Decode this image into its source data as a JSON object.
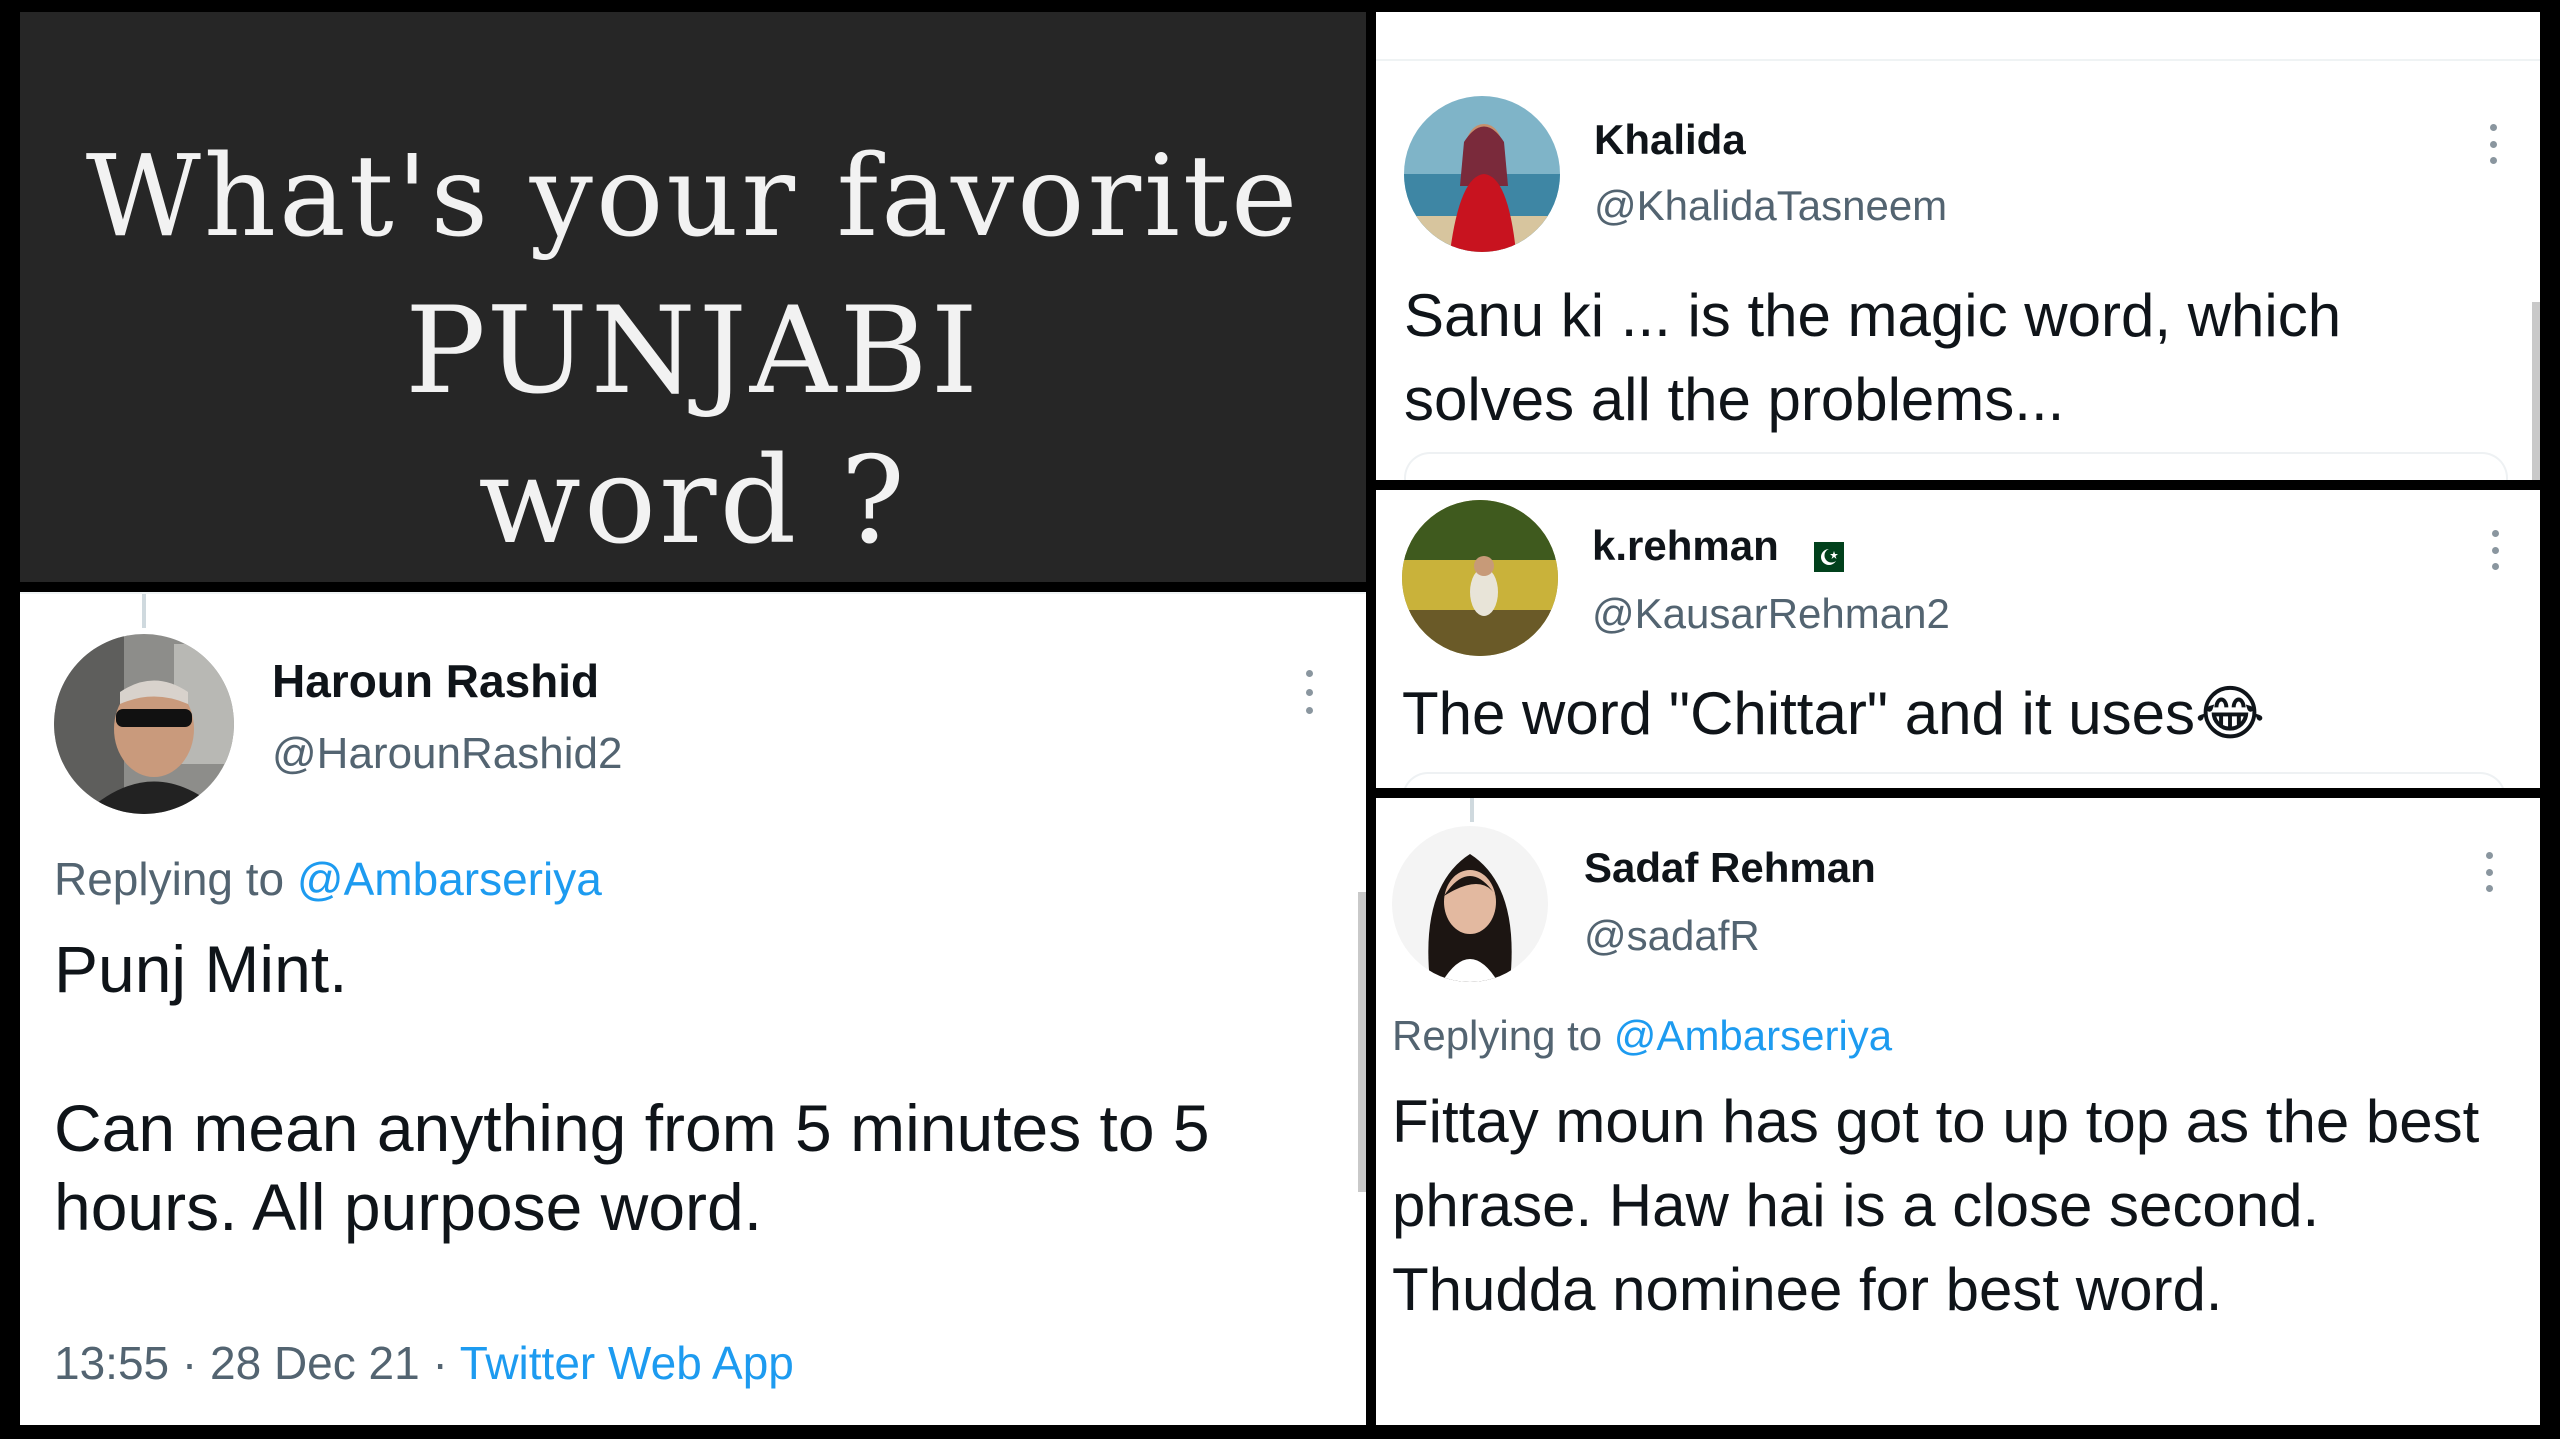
{
  "title_card": {
    "line1": "What's your favorite",
    "line2": "PUNJABI",
    "line3": "word ?"
  },
  "tweets": [
    {
      "name": "Haroun Rashid",
      "handle": "@HarounRashid2",
      "replying_prefix": "Replying to",
      "replying_to": "@Ambarseriya",
      "text_line1": "Punj Mint.",
      "text_line2": "Can mean anything from 5 minutes to 5 hours. All purpose word.",
      "time": "13:55",
      "separator": "·",
      "date": "28 Dec 21",
      "source": "Twitter Web App"
    },
    {
      "name": "Khalida",
      "handle": "@KhalidaTasneem",
      "text": "Sanu ki ... is the magic word, which solves all the problems..."
    },
    {
      "name": "k.rehman",
      "flag": "pakistan-flag-icon",
      "handle": "@KausarRehman2",
      "text": "The word \"Chittar\" and it uses",
      "emoji": "😂"
    },
    {
      "name": "Sadaf Rehman",
      "handle": "@sadafR",
      "replying_prefix": "Replying to",
      "replying_to": "@Ambarseriya",
      "text": "Fittay moun has got to up top as the best phrase. Haw hai is a close second.  Thudda nominee for best word."
    }
  ],
  "colors": {
    "title_bg": "#262626",
    "title_text": "#f2f2f2",
    "link": "#1d9bf0",
    "secondary_text": "#536471",
    "primary_text": "#0f1419"
  }
}
